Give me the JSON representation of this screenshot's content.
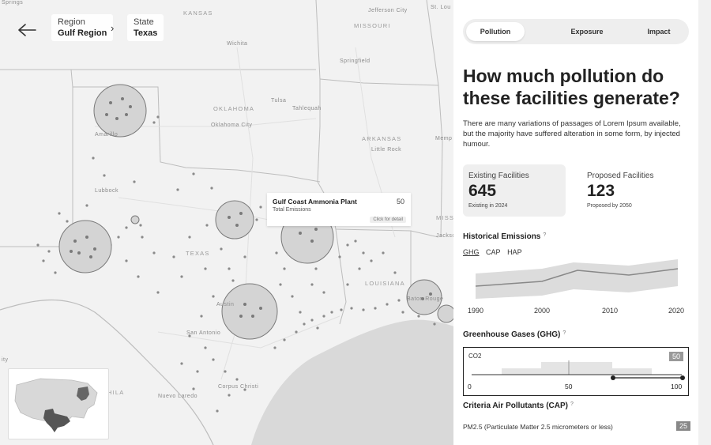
{
  "breadcrumb": {
    "region_label": "Region",
    "region_value": "Gulf Region",
    "state_label": "State",
    "state_value": "Texas",
    "separator": "›"
  },
  "map_labels": {
    "kansas": "KANSAS",
    "missouri": "MISSOURI",
    "oklahoma": "OKLAHOMA",
    "arkansas": "ARKANSAS",
    "texas": "TEXAS",
    "louisiana": "LOUISIANA",
    "miss": "MISS",
    "wichita": "Wichita",
    "springfield": "Springfield",
    "jefferson_city": "Jefferson City",
    "st_lou": "St. Lou",
    "tulsa": "Tulsa",
    "tahlequah": "Tahlequah",
    "oklahoma_city": "Oklahoma City",
    "little_rock": "Little Rock",
    "amarillo": "Amarillo",
    "lubbock": "Lubbock",
    "austin": "Austin",
    "san_antonio": "San Antonio",
    "nuevo_laredo": "Nuevo Laredo",
    "corpus_christi": "Corpus Christi",
    "jackson": "Jackso",
    "baton_rouge": "Baton Rouge",
    "memphis": "Memp",
    "springs": "Springs",
    "hila": "HILA",
    "ity": "ity"
  },
  "tooltip": {
    "name": "Gulf Coast Ammonia Plant",
    "value": "50",
    "subtitle": "Total Emissions",
    "cta": "Click for detail"
  },
  "panel": {
    "tabs": [
      {
        "label": "Pollution",
        "active": true
      },
      {
        "label": "Exposure",
        "active": false
      },
      {
        "label": "Impact",
        "active": false
      }
    ],
    "title": "How much pollution do these facilities generate?",
    "description": "There are many variations of passages of Lorem Ipsum available, but the majority have suffered alteration in some form, by injected humour.",
    "existing": {
      "label": "Existing Facilities",
      "value": "645",
      "note": "Existing in 2024"
    },
    "proposed": {
      "label": "Proposed Facilities",
      "value": "123",
      "note": "Proposed by 2050"
    },
    "historical_title": "Historical Emissions",
    "info_glyph": "?",
    "historical_tabs": [
      "GHG",
      "CAP",
      "HAP"
    ],
    "historical_axis": [
      "1990",
      "2000",
      "2010",
      "2020"
    ],
    "ghg_title": "Greenhouse Gases (GHG)",
    "ghg_gas": "CO2",
    "ghg_badge": "50",
    "ghg_ticks": [
      "0",
      "50",
      "100"
    ],
    "cap_title": "Criteria Air Pollutants (CAP)",
    "pm_label": "PM2.5 (Particulate Matter 2.5 micrometers or less)",
    "pm_badge": "25"
  },
  "colors": {
    "accent": "#222222",
    "bubble": "#d4d4d4",
    "dot": "#8a8a8a",
    "water": "#d9d9d9",
    "card_bg": "#efefef"
  }
}
